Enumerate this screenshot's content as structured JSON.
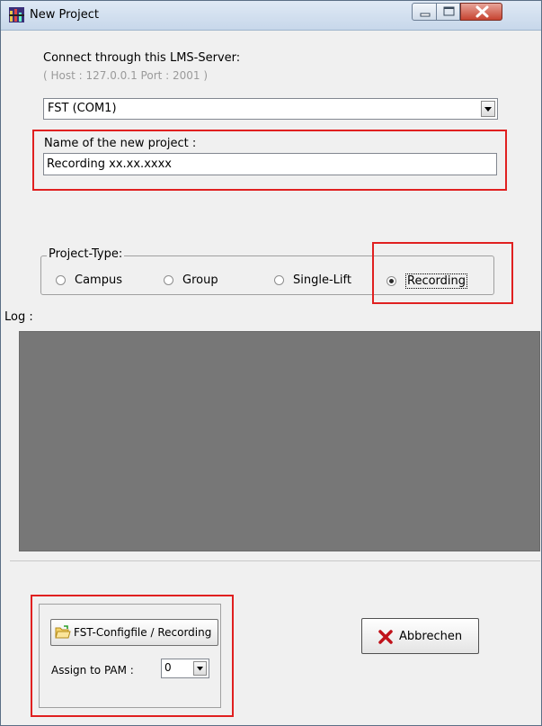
{
  "window": {
    "title": "New Project",
    "controls": {
      "minimize_icon": "minimize-icon",
      "maximize_icon": "maximize-icon",
      "close_icon": "close-icon"
    }
  },
  "server": {
    "label": "Connect through this LMS-Server:",
    "host_info": "( Host : 127.0.0.1  Port : 2001 )",
    "selected": "FST (COM1)"
  },
  "project_name": {
    "label": "Name of the new project :",
    "value": "Recording xx.xx.xxxx"
  },
  "project_type": {
    "legend": "Project-Type:",
    "options": [
      "Campus",
      "Group",
      "Single-Lift",
      "Recording"
    ],
    "selected": "Recording"
  },
  "log": {
    "label": "Log :"
  },
  "actions": {
    "config_button": "FST-Configfile / Recording",
    "assign_label": "Assign to PAM :",
    "pam_value": "0",
    "cancel_button": "Abbrechen"
  },
  "colors": {
    "highlight": "#e02020",
    "log_background": "#777777",
    "cancel_icon": "#c0121a"
  }
}
